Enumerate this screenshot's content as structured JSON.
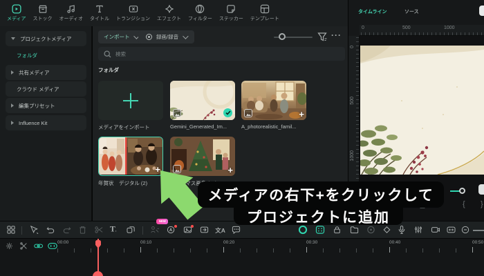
{
  "accent_color": "#45d6b3",
  "tabbar": {
    "tabs": [
      {
        "label": "メディア",
        "active": true
      },
      {
        "label": "ストック",
        "active": false
      },
      {
        "label": "オーディオ",
        "active": false
      },
      {
        "label": "タイトル",
        "active": false
      },
      {
        "label": "トランジション",
        "active": false
      },
      {
        "label": "エフェクト",
        "active": false
      },
      {
        "label": "フィルター",
        "active": false
      },
      {
        "label": "ステッカー",
        "active": false
      },
      {
        "label": "テンプレート",
        "active": false
      }
    ]
  },
  "sidebar": {
    "items": [
      {
        "label": "プロジェクトメディア",
        "arrow": "down",
        "active": false
      },
      {
        "label": "フォルダ",
        "arrow": "",
        "active": true
      },
      {
        "label": "共有メディア",
        "arrow": "right",
        "active": false
      },
      {
        "label": "クラウド メディア",
        "arrow": "",
        "active": false
      },
      {
        "label": "編集プリセット",
        "arrow": "right",
        "active": false
      },
      {
        "label": "Influence Kit",
        "arrow": "right",
        "active": false
      }
    ]
  },
  "media_panel": {
    "import_button": "インポート",
    "record_button": "録画/録音",
    "search_placeholder": "検索",
    "section_title": "フォルダ",
    "items": [
      {
        "label": "メディアをインポート",
        "type": "import-tile"
      },
      {
        "label": "Gemini_Generated_Im...",
        "type": "image",
        "checked": true
      },
      {
        "label": "A_photorealistic_famil...",
        "type": "image"
      },
      {
        "label": "年賀状　デジタル (2)",
        "type": "folder",
        "selected": true
      },
      {
        "label": "クリスマス画像 (36)",
        "type": "folder"
      }
    ]
  },
  "right_panel": {
    "tabs": [
      {
        "label": "タイムライン",
        "active": true
      },
      {
        "label": "ソース",
        "active": false
      }
    ],
    "h_ruler_labels": [
      "0",
      "500",
      "1000"
    ],
    "v_ruler_labels": [
      "0",
      "500",
      "1000"
    ],
    "brace_open": "{",
    "brace_close": "}"
  },
  "tooltip": {
    "line1": "メディアの右下+をクリックして",
    "line2": "プロジェクトに追加"
  },
  "toolbar": {
    "new_badge": "NEW",
    "translate_label": "文A"
  },
  "timeline": {
    "time_labels": [
      "00:00",
      "00:10",
      "00:20",
      "00:30",
      "00:40",
      "00:50"
    ]
  }
}
